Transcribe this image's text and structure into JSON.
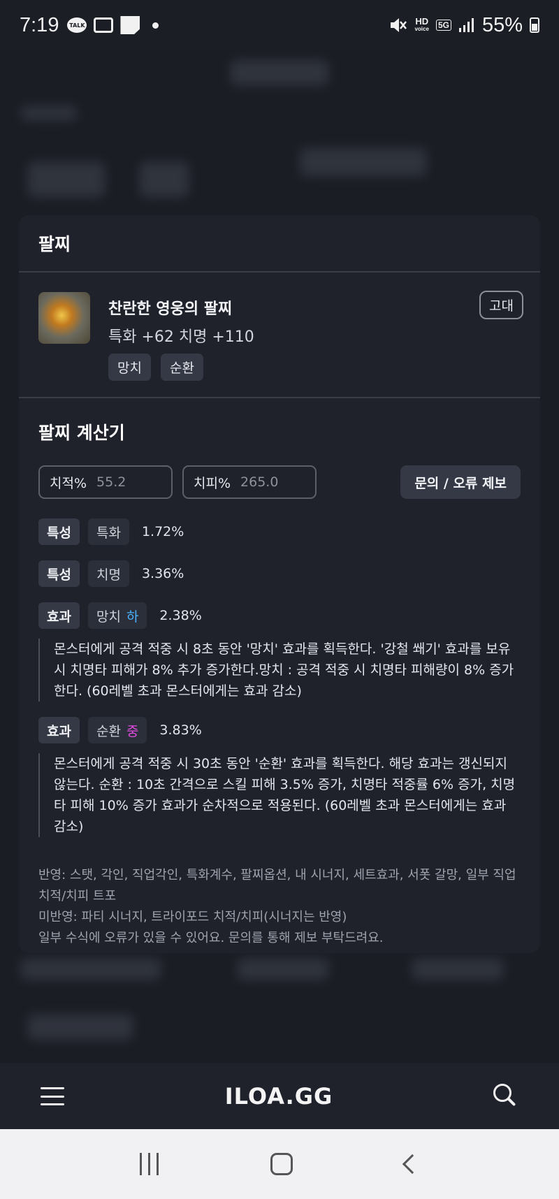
{
  "status_bar": {
    "time": "7:19",
    "talk_label": "TALK",
    "hd_label": "HD",
    "hd_sub": "voice",
    "net_label": "5G",
    "battery": "55%"
  },
  "modal": {
    "title": "팔찌",
    "item": {
      "name": "찬란한 영웅의 팔찌",
      "stats": "특화 +62  치명 +110",
      "tags": [
        "망치",
        "순환"
      ],
      "grade": "고대"
    },
    "calc": {
      "title": "팔찌 계산기",
      "crit_rate_label": "치적%",
      "crit_rate_value": "55.2",
      "crit_dmg_label": "치피%",
      "crit_dmg_value": "265.0",
      "report_button": "문의 / 오류 제보",
      "rows": [
        {
          "type": "특성",
          "name": "특화",
          "pct": "1.72%"
        },
        {
          "type": "특성",
          "name": "치명",
          "pct": "3.36%"
        },
        {
          "type": "효과",
          "name": "망치",
          "level": "하",
          "pct": "2.38%",
          "desc": "몬스터에게 공격 적중 시 8초 동안 '망치' 효과를 획득한다. '강철 쐐기' 효과를 보유 시 치명타 피해가 8% 추가 증가한다.망치 : 공격 적중 시 치명타 피해량이 8% 증가한다. (60레벨 초과 몬스터에게는 효과 감소)"
        },
        {
          "type": "효과",
          "name": "순환",
          "level": "중",
          "pct": "3.83%",
          "desc": "몬스터에게 공격 적중 시 30초 동안 '순환' 효과를 획득한다. 해당 효과는 갱신되지 않는다. 순환 : 10초 간격으로 스킬 피해 3.5% 증가, 치명타 적중률 6% 증가, 치명타 피해 10% 증가 효과가 순차적으로 적용된다. (60레벨 초과 몬스터에게는 효과 감소)"
        }
      ],
      "notes": [
        "반영: 스탯, 각인, 직업각인, 특화계수, 팔찌옵션, 내 시너지, 세트효과, 서폿 갈망, 일부 직업 치적/치피 트포",
        "미반영: 파티 시너지, 트라이포드 치적/치피(시너지는 반영)",
        "일부 수식에 오류가 있을 수 있어요. 문의를 통해 제보 부탁드려요."
      ]
    }
  },
  "bottom_nav": {
    "brand": "ILOA.GG"
  },
  "colors": {
    "level_low": "#4ab1ff",
    "level_mid": "#e24ae0"
  }
}
